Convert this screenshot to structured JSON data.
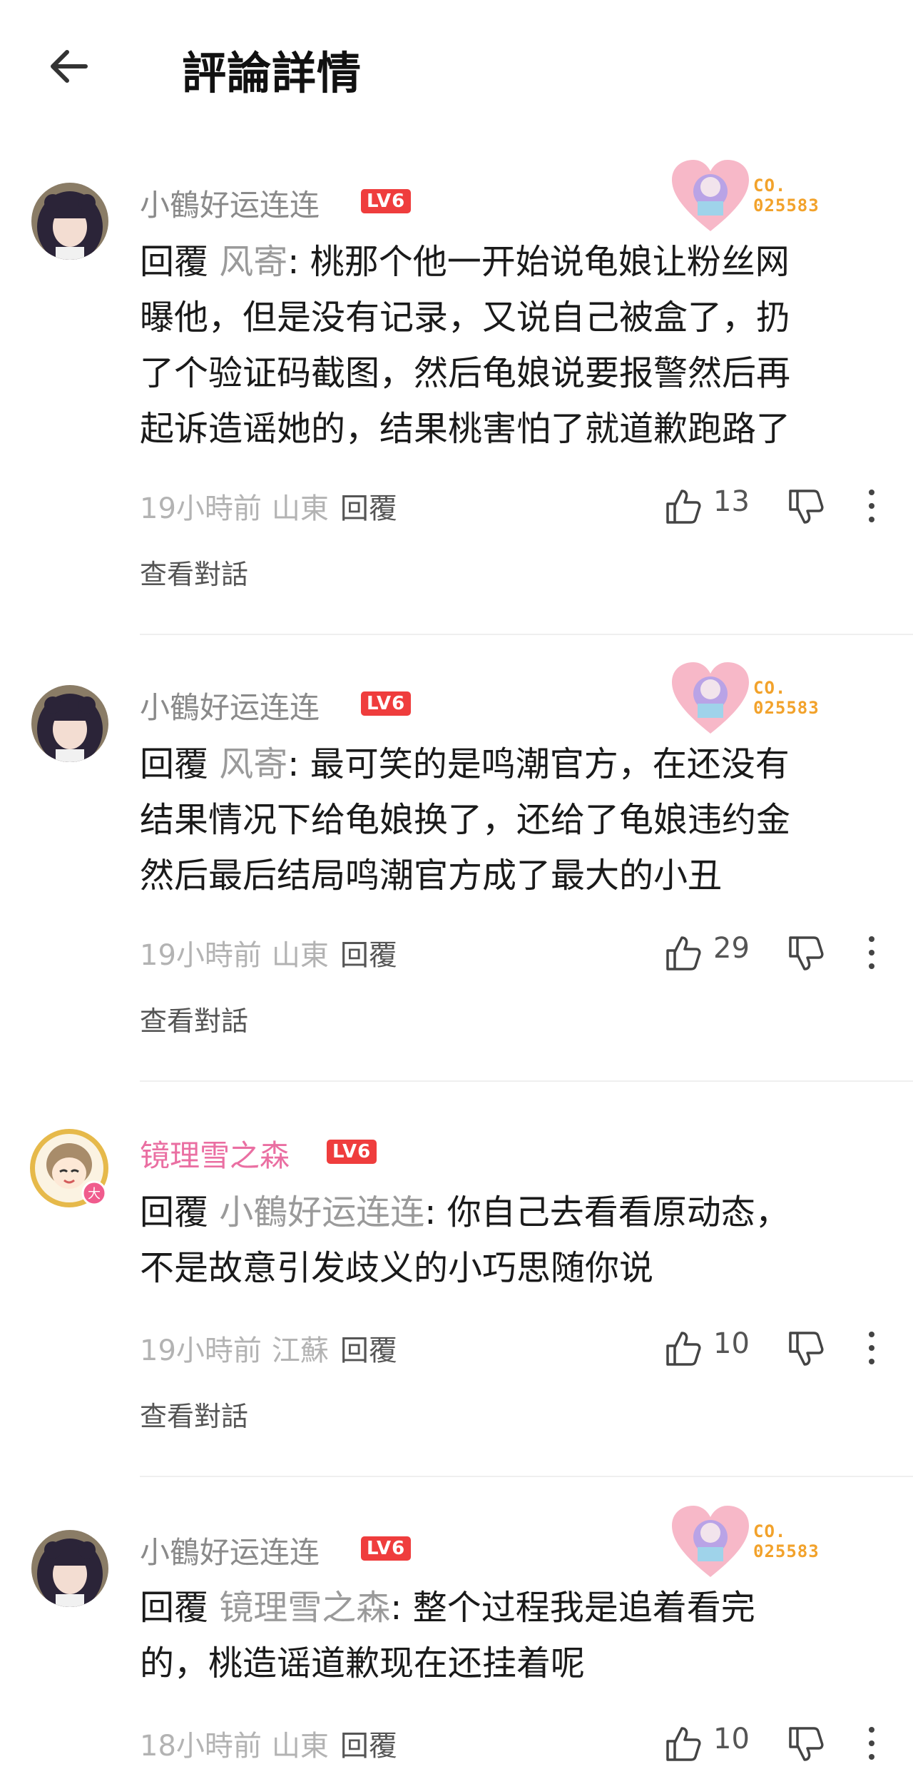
{
  "header": {
    "title": "評論詳情"
  },
  "badge_code": [
    "CO.",
    "025583"
  ],
  "comments": [
    {
      "username": "小鶴好运连连",
      "level": "LV6",
      "reply_word": "回覆",
      "reply_target": "风寄",
      "text_lines": [
        "桃那个他一开始说龟娘让粉丝网",
        "曝他，但是没有记录，又说自己被盒了，扔",
        "了个验证码截图，然后龟娘说要报警然后再",
        "起诉造谣她的，结果桃害怕了就道歉跑路了"
      ],
      "time": "19小時前",
      "location": "山東",
      "reply_label": "回覆",
      "likes": "13",
      "view_conversation": "查看對話"
    },
    {
      "username": "小鶴好运连连",
      "level": "LV6",
      "reply_word": "回覆",
      "reply_target": "风寄",
      "text_lines": [
        "最可笑的是鸣潮官方，在还没有",
        "结果情况下给龟娘换了，还给了龟娘违约金",
        "然后最后结局鸣潮官方成了最大的小丑"
      ],
      "time": "19小時前",
      "location": "山東",
      "reply_label": "回覆",
      "likes": "29",
      "view_conversation": "查看對話"
    },
    {
      "username": "镜理雪之森",
      "level": "LV6",
      "reply_word": "回覆",
      "reply_target": "小鶴好运连连",
      "text_lines": [
        "你自己去看看原动态，",
        "不是故意引发歧义的小巧思随你说"
      ],
      "time": "19小時前",
      "location": "江蘇",
      "reply_label": "回覆",
      "likes": "10",
      "view_conversation": "查看對話"
    },
    {
      "username": "小鶴好运连连",
      "level": "LV6",
      "reply_word": "回覆",
      "reply_target": "镜理雪之森",
      "text_lines": [
        "整个过程我是追着看完",
        "的，桃造谣道歉现在还挂着呢"
      ],
      "time": "18小時前",
      "location": "山東",
      "reply_label": "回覆",
      "likes": "10"
    }
  ]
}
